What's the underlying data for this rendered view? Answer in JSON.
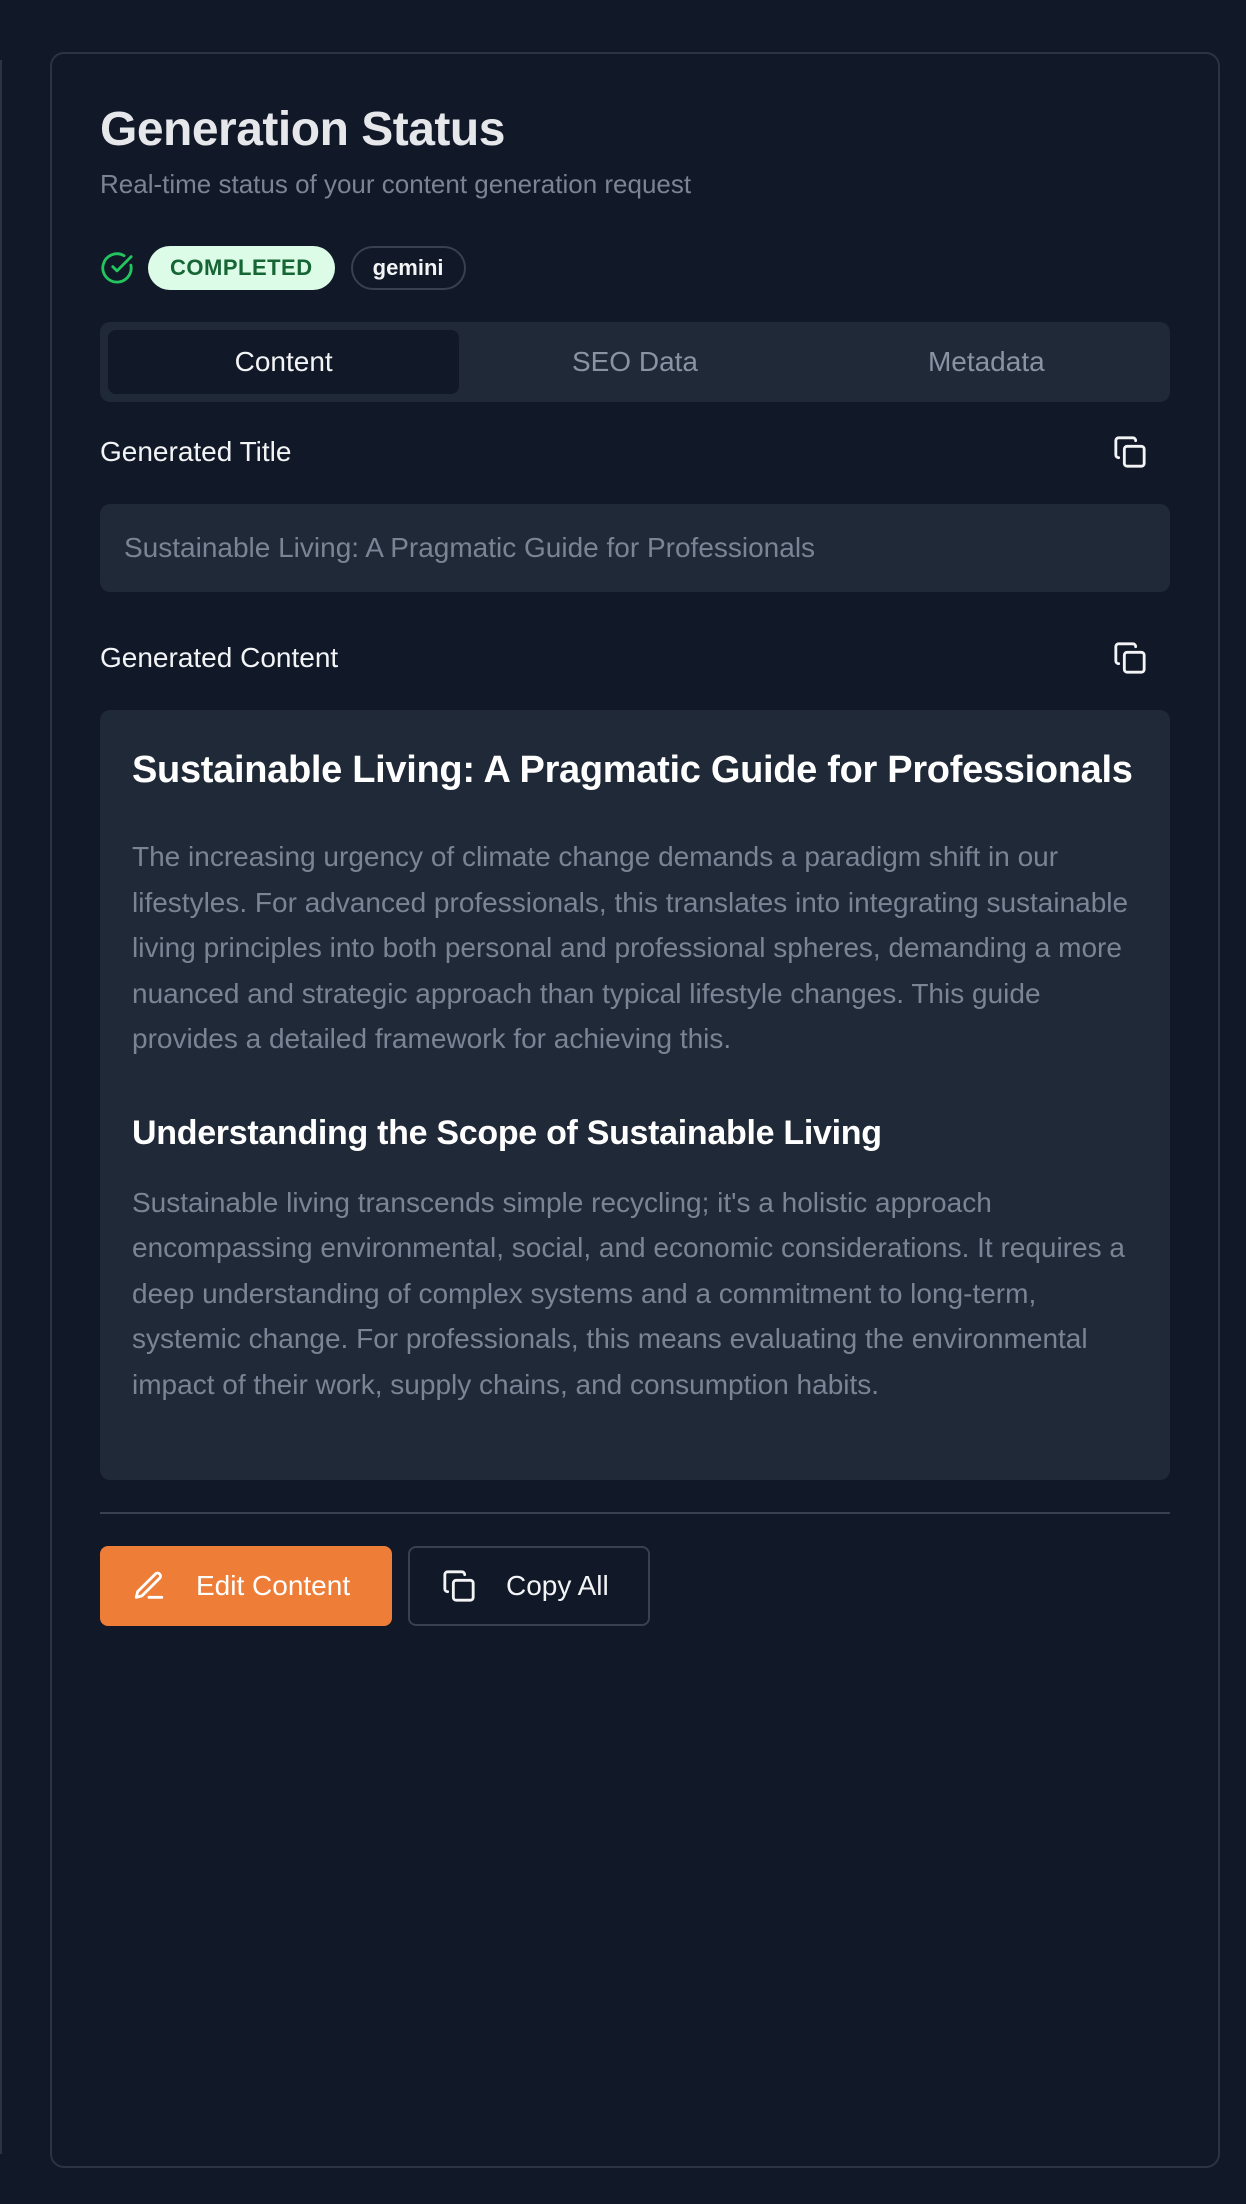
{
  "header": {
    "title": "Generation Status",
    "subtitle": "Real-time status of your content generation request"
  },
  "status": {
    "badge": "COMPLETED",
    "model": "gemini",
    "colors": {
      "success": "#22c55e",
      "badge_bg": "#dcfce7",
      "badge_text": "#166534"
    }
  },
  "tabs": [
    {
      "label": "Content",
      "active": true
    },
    {
      "label": "SEO Data",
      "active": false
    },
    {
      "label": "Metadata",
      "active": false
    }
  ],
  "fields": {
    "title_label": "Generated Title",
    "title_value": "Sustainable Living: A Pragmatic Guide for Professionals",
    "content_label": "Generated Content"
  },
  "content": {
    "heading": "Sustainable Living: A Pragmatic Guide for Professionals",
    "intro": "The increasing urgency of climate change demands a paradigm shift in our lifestyles. For advanced professionals, this translates into integrating sustainable living principles into both personal and professional spheres, demanding a more nuanced and strategic approach than typical lifestyle changes. This guide provides a detailed framework for achieving this.",
    "section_heading": "Understanding the Scope of Sustainable Living",
    "section_body": "Sustainable living transcends simple recycling; it's a holistic approach encompassing environmental, social, and economic considerations. It requires a deep understanding of complex systems and a commitment to long-term, systemic change. For professionals, this means evaluating the environmental impact of their work, supply chains, and consumption habits."
  },
  "actions": {
    "edit_label": "Edit Content",
    "copy_all_label": "Copy All",
    "accent": "#ed7d37"
  },
  "icons": {
    "status": "check-circle-icon",
    "copy": "copy-icon",
    "edit": "pencil-icon"
  }
}
